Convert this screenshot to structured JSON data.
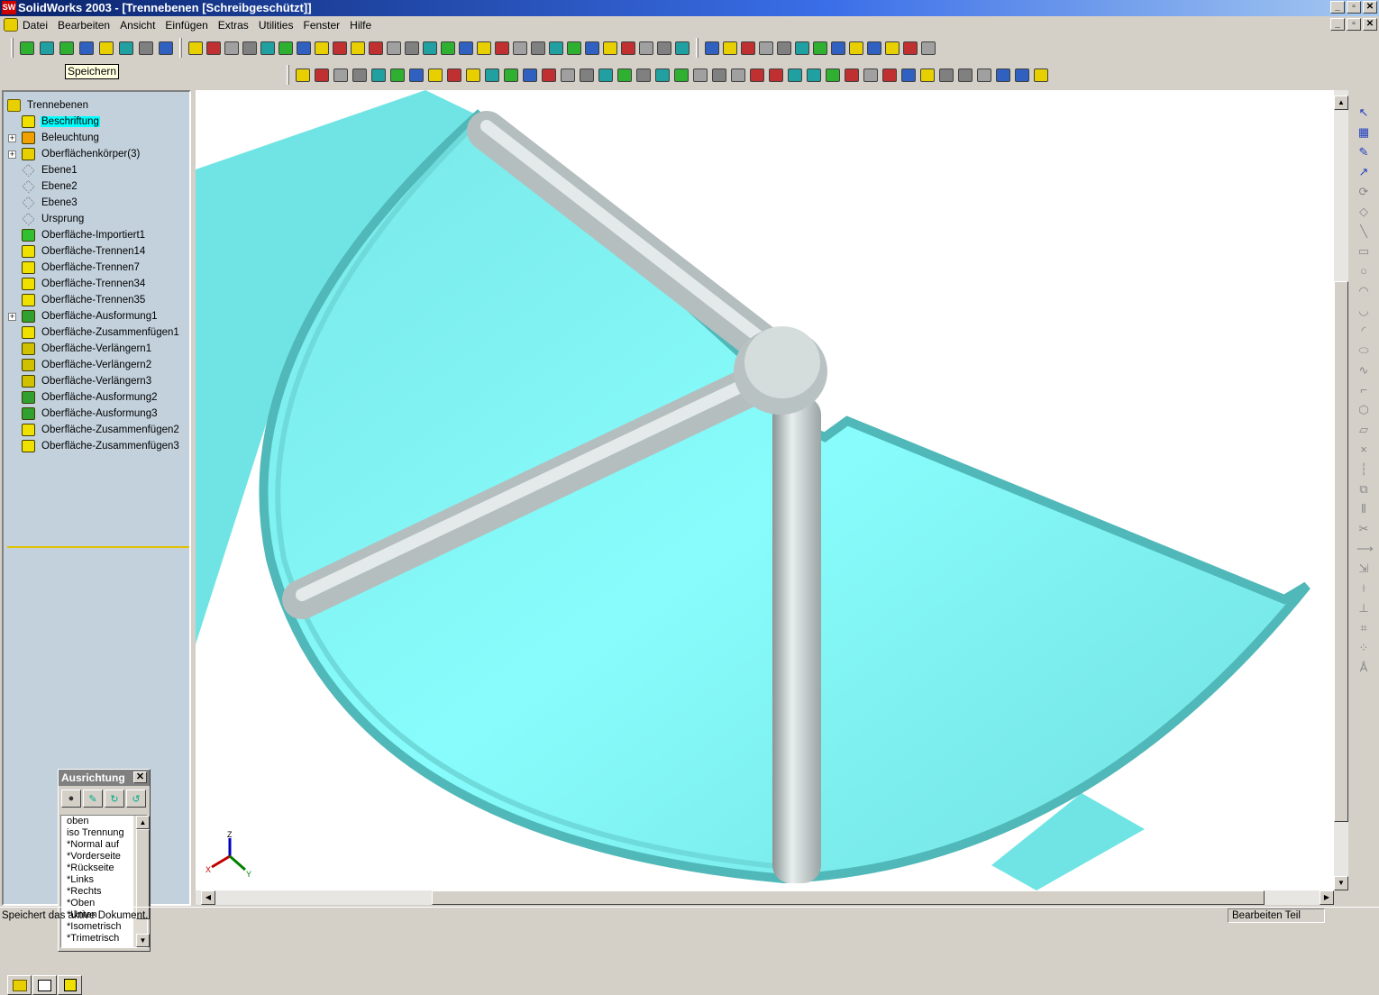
{
  "window": {
    "title": "SolidWorks 2003 - [Trennebenen [Schreibgeschützt]]",
    "logo": "SW"
  },
  "menu": [
    "Datei",
    "Bearbeiten",
    "Ansicht",
    "Einfügen",
    "Extras",
    "Utilities",
    "Fenster",
    "Hilfe"
  ],
  "tooltip": "Speichern",
  "toolbar1_left": [
    "new-icon",
    "open-icon",
    "save-icon",
    "undo-icon",
    "redo-icon",
    "traffic-light-icon",
    "rebuild-icon",
    "color-palette-icon"
  ],
  "toolbar1_mid": [
    "feature-1-icon",
    "feature-2-icon",
    "feature-3-icon",
    "feature-4-icon",
    "feature-5-icon",
    "feature-6-icon",
    "feature-7-icon",
    "feature-8-icon",
    "feature-9-icon",
    "feature-10-icon",
    "feature-11-icon",
    "feature-12-icon",
    "feature-13-icon",
    "feature-14-icon",
    "feature-15-icon",
    "feature-16-icon",
    "feature-17-icon",
    "feature-18-icon",
    "feature-19-icon",
    "feature-20-icon",
    "feature-21-icon",
    "feature-22-icon",
    "feature-23-icon",
    "feature-24-icon",
    "feature-25-icon",
    "feature-26-icon",
    "feature-27-icon",
    "feature-28-icon"
  ],
  "toolbar1_right": [
    "tool-1-icon",
    "tool-2-icon",
    "tool-3-icon",
    "tool-4-icon",
    "tool-5-icon",
    "tool-6-icon",
    "tool-7-icon",
    "tool-8-icon",
    "tool-9-icon",
    "tool-10-icon",
    "tool-11-icon",
    "tool-12-icon",
    "tool-13-icon"
  ],
  "toolbar2": [
    "surface-1-icon",
    "surface-2-icon",
    "surface-3-icon",
    "surface-4-icon",
    "surface-5-icon",
    "surface-6-icon",
    "surface-7-icon",
    "surface-8-icon",
    "surface-9-icon",
    "surface-10-icon",
    "ref-1-icon",
    "ref-2-icon",
    "ref-3-icon",
    "sketch-1-icon",
    "sketch-2-icon",
    "sketch-3-icon",
    "sketch-4-icon",
    "sketch-5-icon",
    "view-1-icon",
    "view-2-icon",
    "select-icon",
    "select-2-icon",
    "zoom-fit-icon",
    "zoom-area-icon",
    "zoom-inout-icon",
    "zoom-selection-icon",
    "rotate-icon",
    "pan-icon",
    "view-front-icon",
    "view-back-icon",
    "view-left-icon",
    "view-right-icon",
    "view-top-icon",
    "view-iso-icon",
    "measure-icon",
    "mass-icon",
    "clock-icon",
    "section-icon",
    "dims-icon",
    "grid-icon"
  ],
  "tree": {
    "root": "Trennebenen",
    "items": [
      {
        "label": "Beschriftung",
        "icon": "annotation-icon",
        "color": "#f0e000",
        "expand": false,
        "selected": true
      },
      {
        "label": "Beleuchtung",
        "icon": "lighting-icon",
        "color": "#f0a000",
        "expand": true
      },
      {
        "label": "Oberflächenkörper(3)",
        "icon": "surface-bodies-icon",
        "color": "#e8d000",
        "expand": true
      },
      {
        "label": "Ebene1",
        "icon": "plane-icon",
        "color": "none",
        "expand": false
      },
      {
        "label": "Ebene2",
        "icon": "plane-icon",
        "color": "none",
        "expand": false
      },
      {
        "label": "Ebene3",
        "icon": "plane-icon",
        "color": "none",
        "expand": false
      },
      {
        "label": "Ursprung",
        "icon": "origin-icon",
        "color": "none",
        "expand": false
      },
      {
        "label": "Oberfläche-Importiert1",
        "icon": "imported-surface-icon",
        "color": "#30c030",
        "expand": false
      },
      {
        "label": "Oberfläche-Trennen14",
        "icon": "split-surface-icon",
        "color": "#f0e000",
        "expand": false
      },
      {
        "label": "Oberfläche-Trennen7",
        "icon": "split-surface-icon",
        "color": "#f0e000",
        "expand": false
      },
      {
        "label": "Oberfläche-Trennen34",
        "icon": "split-surface-icon",
        "color": "#f0e000",
        "expand": false
      },
      {
        "label": "Oberfläche-Trennen35",
        "icon": "split-surface-icon",
        "color": "#f0e000",
        "expand": false
      },
      {
        "label": "Oberfläche-Ausformung1",
        "icon": "loft-surface-icon",
        "color": "#30a030",
        "expand": true
      },
      {
        "label": "Oberfläche-Zusammenfügen1",
        "icon": "knit-surface-icon",
        "color": "#f0e000",
        "expand": false
      },
      {
        "label": "Oberfläche-Verlängern1",
        "icon": "extend-surface-icon",
        "color": "#d0c000",
        "expand": false
      },
      {
        "label": "Oberfläche-Verlängern2",
        "icon": "extend-surface-icon",
        "color": "#d0c000",
        "expand": false
      },
      {
        "label": "Oberfläche-Verlängern3",
        "icon": "extend-surface-icon",
        "color": "#d0c000",
        "expand": false
      },
      {
        "label": "Oberfläche-Ausformung2",
        "icon": "loft-surface-icon",
        "color": "#30a030",
        "expand": false
      },
      {
        "label": "Oberfläche-Ausformung3",
        "icon": "loft-surface-icon",
        "color": "#30a030",
        "expand": false
      },
      {
        "label": "Oberfläche-Zusammenfügen2",
        "icon": "knit-surface-icon",
        "color": "#f0e000",
        "expand": false
      },
      {
        "label": "Oberfläche-Zusammenfügen3",
        "icon": "knit-surface-icon",
        "color": "#f0e000",
        "expand": false
      }
    ]
  },
  "orientation": {
    "title": "Ausrichtung",
    "close": "✕",
    "views": [
      "oben",
      "iso Trennung",
      "*Normal auf",
      "*Vorderseite",
      "*Rückseite",
      "*Links",
      "*Rechts",
      "*Oben",
      "*Unten",
      "*Isometrisch",
      "*Trimetrisch"
    ]
  },
  "triad": {
    "x": "X",
    "y": "Y",
    "z": "Z"
  },
  "righttoolbar": [
    "select-icon",
    "grid-icon",
    "sketch-icon",
    "smart-dim-icon",
    "rotate-icon",
    "eraser-icon",
    "line-icon",
    "rect-icon",
    "circle-icon",
    "arc-icon",
    "tangent-arc-icon",
    "3pt-arc-icon",
    "ellipse-icon",
    "spline-icon",
    "fillet-icon",
    "polygon-icon",
    "parallelogram-icon",
    "point-icon",
    "centerline-icon",
    "offset-icon",
    "mirror-icon",
    "trim-icon",
    "extend-icon",
    "convert-icon",
    "split-icon",
    "relations-icon",
    "scan-icon",
    "pattern-icon",
    "more-icon"
  ],
  "status": {
    "left": "Speichert das aktive Dokument.",
    "right": "Bearbeiten Teil"
  },
  "colors": {
    "surface": "#7ff5f5",
    "surface_dark": "#5dcfcf",
    "tube": "#c8d0d0",
    "select": "#00ffff"
  }
}
